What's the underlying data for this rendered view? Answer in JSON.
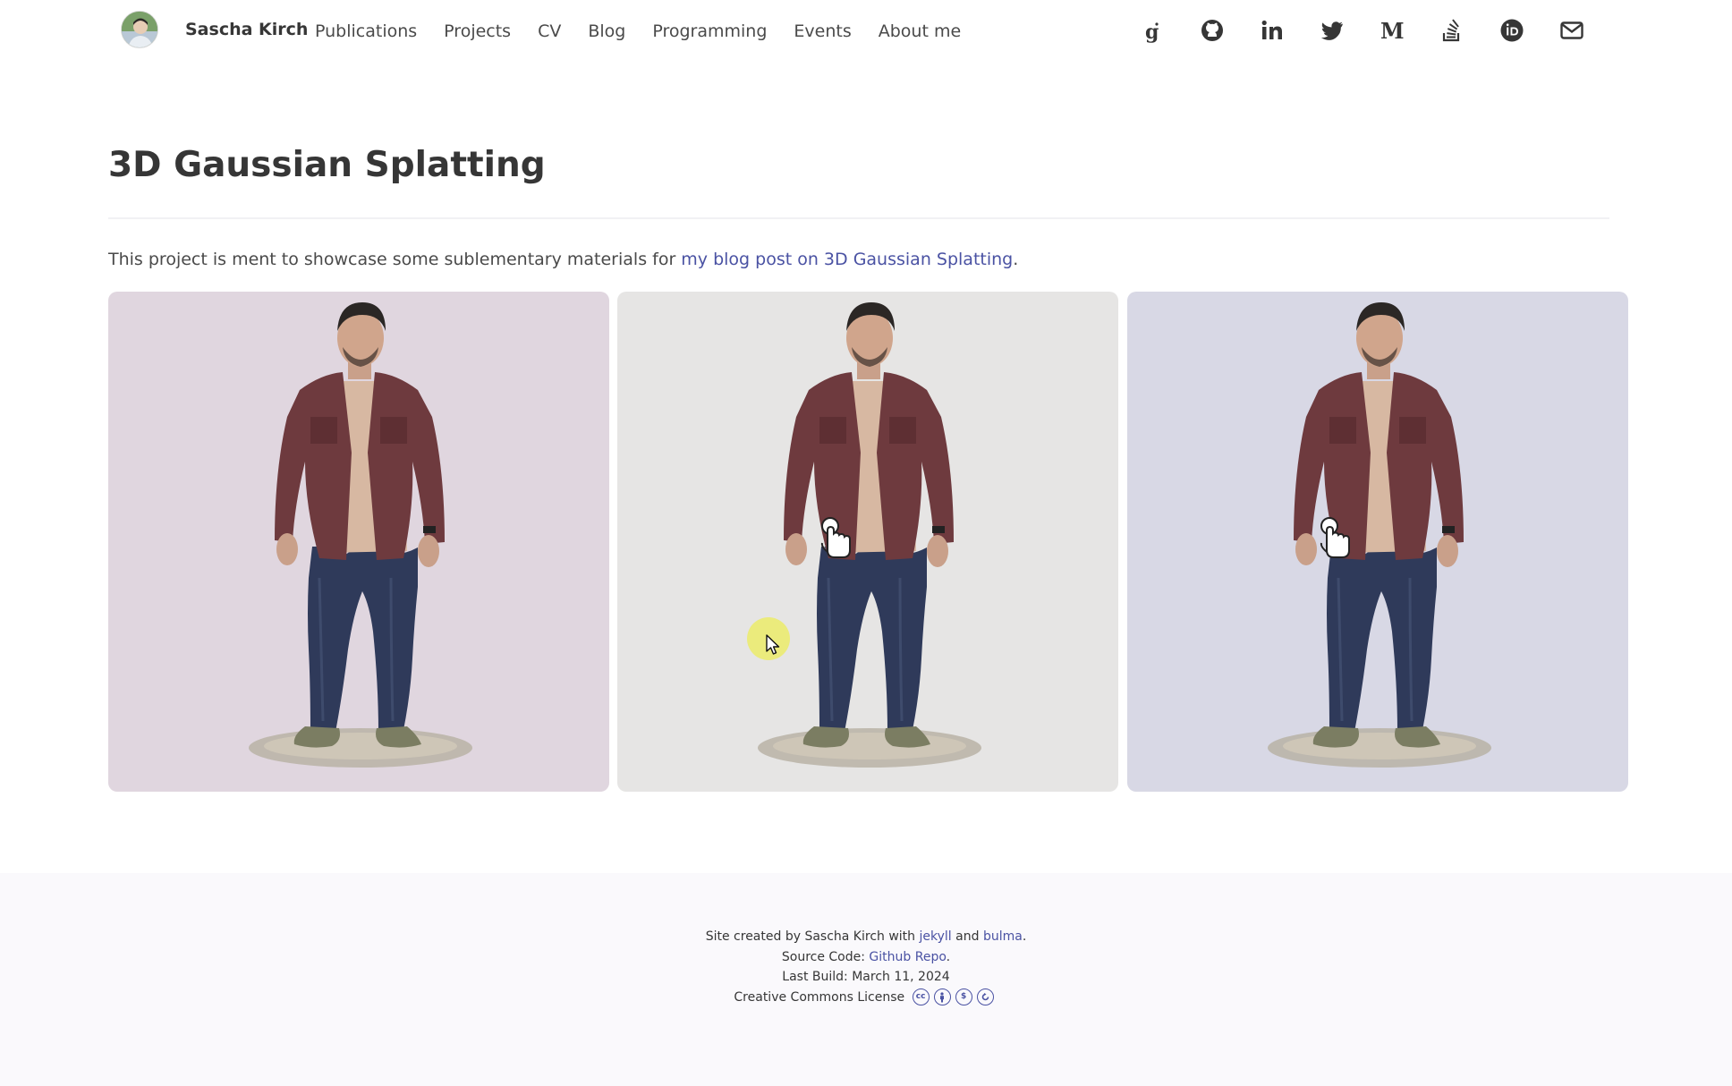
{
  "navbar": {
    "brand_name": "Sascha Kirch",
    "items": [
      {
        "label": "Publications"
      },
      {
        "label": "Projects"
      },
      {
        "label": "CV"
      },
      {
        "label": "Blog"
      },
      {
        "label": "Programming"
      },
      {
        "label": "Events"
      },
      {
        "label": "About me"
      }
    ],
    "social_icons": [
      "google-scholar-icon",
      "github-icon",
      "linkedin-icon",
      "twitter-icon",
      "medium-icon",
      "stackoverflow-icon",
      "orcid-icon",
      "email-icon"
    ]
  },
  "main": {
    "title": "3D Gaussian Splatting",
    "intro_text": "This project is ment to showcase some sublementary materials for ",
    "intro_link": "my blog post on 3D Gaussian Splatting",
    "intro_end": ".",
    "panels": [
      {
        "background": "#e0d6df"
      },
      {
        "background": "#e6e5e4"
      },
      {
        "background": "#d8d8e5"
      }
    ]
  },
  "footer": {
    "line1_prefix": "Site created by Sascha Kirch with ",
    "line1_link1": "jekyll",
    "line1_mid": " and ",
    "line1_link2": "bulma",
    "line1_end": ".",
    "line2_prefix": "Source Code: ",
    "line2_link": "Github Repo",
    "line2_end": ".",
    "line3": "Last Build: March 11, 2024",
    "line4": "Creative Commons License",
    "cc_icons": [
      "cc-icon",
      "by-icon",
      "nc-icon",
      "sa-icon"
    ]
  },
  "colors": {
    "link": "#4a52a3",
    "text": "#363636",
    "footer_bg": "#faf9fc"
  }
}
